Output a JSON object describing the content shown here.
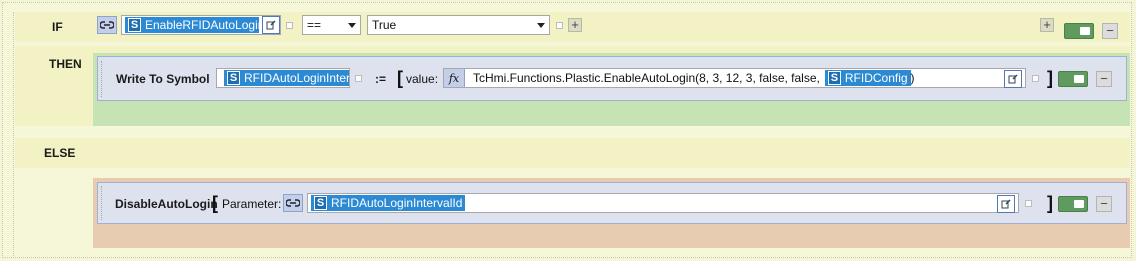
{
  "if": {
    "keyword": "IF",
    "symbol": "EnableRFIDAutoLogin",
    "operator": "==",
    "value": "True"
  },
  "then": {
    "keyword": "THEN",
    "action_label": "Write To Symbol",
    "target_symbol": "RFIDAutoLoginInter",
    "assign_op": ":=",
    "value_label": "value:",
    "fx_icon_text": "fx",
    "expression": "TcHmi.Functions.Plastic.EnableAutoLogin(8, 3, 12, 3, false, false,",
    "expression_symbol": "RFIDConfig",
    "expression_close": ")"
  },
  "else": {
    "keyword": "ELSE",
    "function_name": "DisableAutoLogin",
    "param_label": "Parameter:",
    "param_symbol": "RFIDAutoLoginIntervalId"
  },
  "colors": {
    "row_bg": "#f2f2c4",
    "then_green": "#c6e3b4",
    "else_peach": "#e7ccb2",
    "symbol_blue": "#2b8ad3",
    "toggle_green": "#5f9a5f"
  }
}
